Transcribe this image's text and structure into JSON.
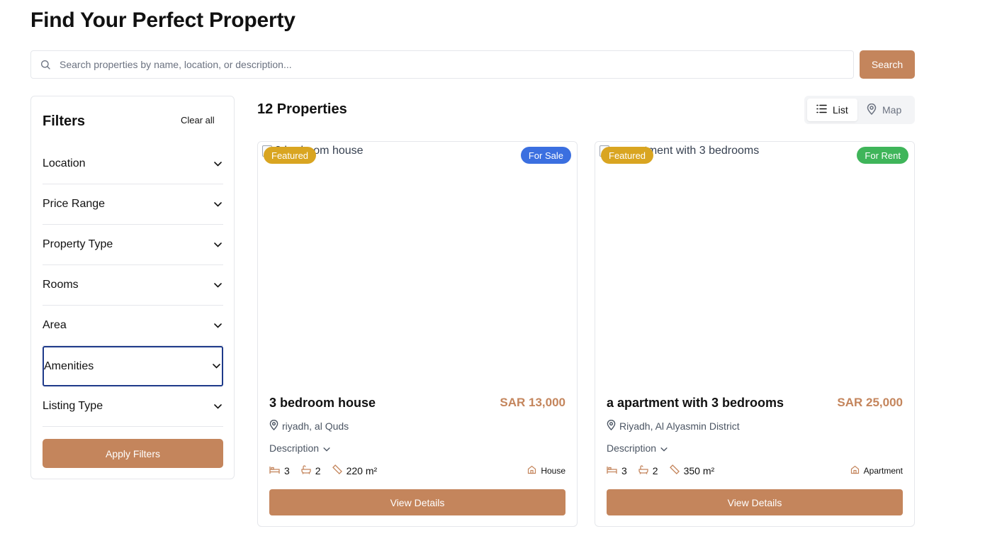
{
  "header": {
    "title": "Find Your Perfect Property"
  },
  "search": {
    "placeholder": "Search properties by name, location, or description...",
    "value": "",
    "button_label": "Search"
  },
  "filters": {
    "title": "Filters",
    "clear_label": "Clear all",
    "items": [
      {
        "label": "Location"
      },
      {
        "label": "Price Range"
      },
      {
        "label": "Property Type"
      },
      {
        "label": "Rooms"
      },
      {
        "label": "Area"
      },
      {
        "label": "Amenities",
        "focused": true
      },
      {
        "label": "Listing Type"
      }
    ],
    "apply_label": "Apply Filters"
  },
  "results": {
    "count_label": "12 Properties",
    "view_toggle": {
      "list_label": "List",
      "map_label": "Map",
      "active": "List"
    }
  },
  "properties": [
    {
      "image_alt": "3 bedroom house",
      "featured_label": "Featured",
      "status_label": "For Sale",
      "title": "3 bedroom house",
      "price": "SAR 13,000",
      "location": "riyadh, al Quds",
      "description_label": "Description",
      "bedrooms": "3",
      "bathrooms": "2",
      "area": "220 m²",
      "type": "House",
      "button_label": "View Details"
    },
    {
      "image_alt": "a apartment with 3 bedrooms",
      "featured_label": "Featured",
      "status_label": "For Rent",
      "title": "a apartment with 3 bedrooms",
      "price": "SAR 25,000",
      "location": "Riyadh, Al Alyasmin District",
      "description_label": "Description",
      "bedrooms": "3",
      "bathrooms": "2",
      "area": "350 m²",
      "type": "Apartment",
      "button_label": "View Details"
    }
  ],
  "colors": {
    "accent": "#c4855c",
    "featured": "#d9a521",
    "for_sale": "#3b6fe0",
    "for_rent": "#3fb55a",
    "focus_ring": "#1e3a8a"
  }
}
